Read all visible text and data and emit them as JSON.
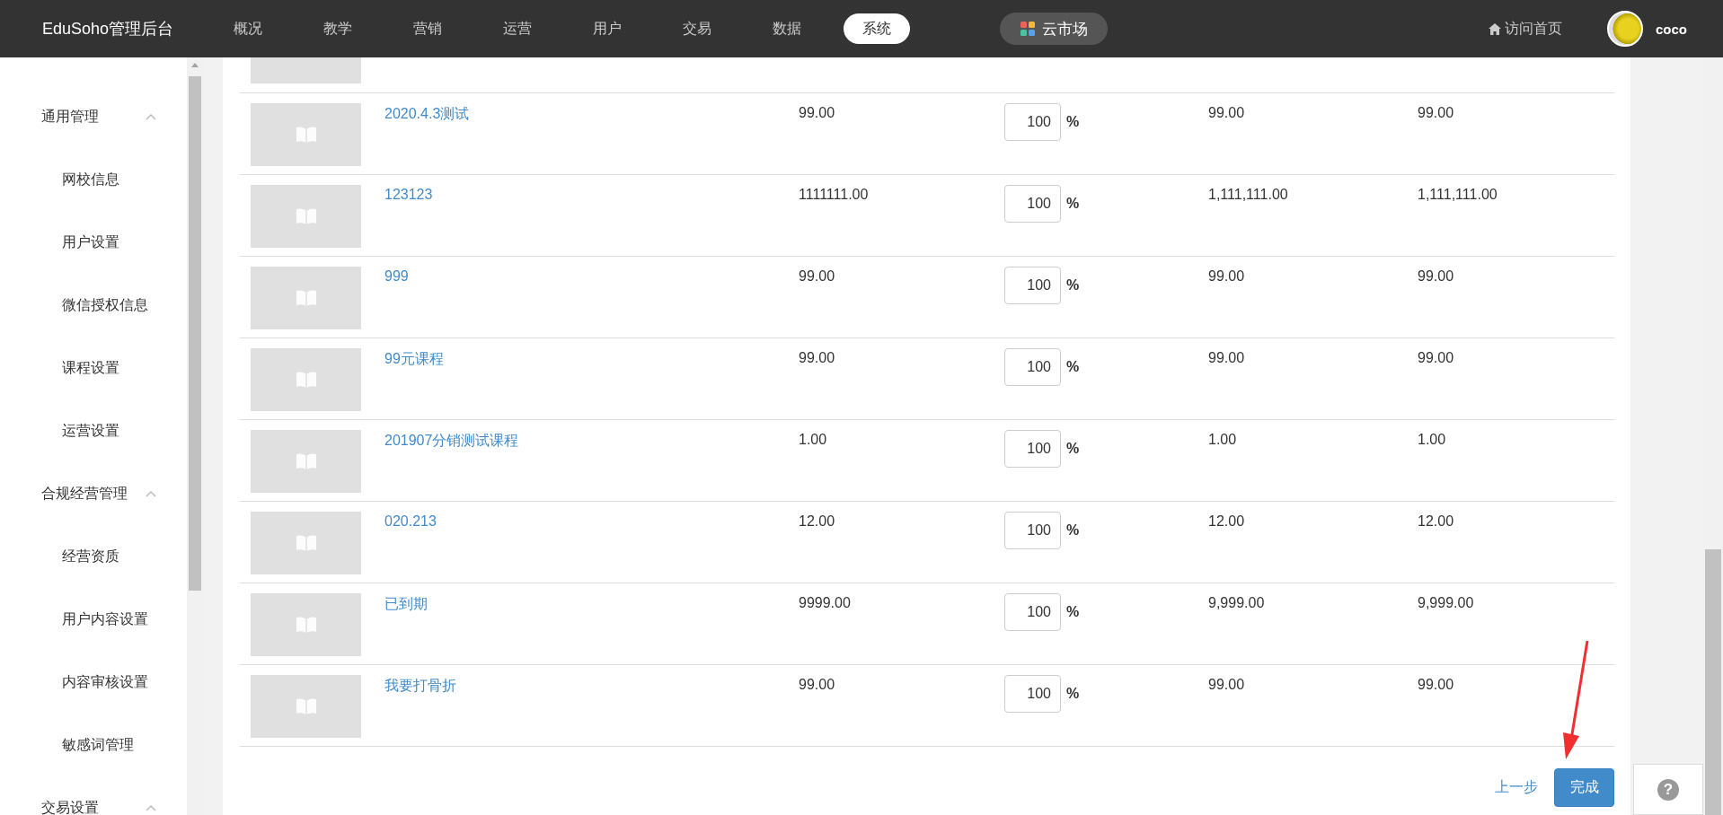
{
  "topbar": {
    "logo": "EduSoho管理后台",
    "nav": [
      {
        "label": "概况",
        "selected": false
      },
      {
        "label": "教学",
        "selected": false
      },
      {
        "label": "营销",
        "selected": false
      },
      {
        "label": "运营",
        "selected": false
      },
      {
        "label": "用户",
        "selected": false
      },
      {
        "label": "交易",
        "selected": false
      },
      {
        "label": "数据",
        "selected": false
      },
      {
        "label": "系统",
        "selected": true
      }
    ],
    "market": "云市场",
    "visit": "访问首页",
    "user": "coco"
  },
  "sidebar": {
    "groups": [
      {
        "label": "通用管理",
        "expanded": true,
        "children": [
          {
            "label": "网校信息"
          },
          {
            "label": "用户设置"
          },
          {
            "label": "微信授权信息"
          },
          {
            "label": "课程设置"
          },
          {
            "label": "运营设置"
          }
        ]
      },
      {
        "label": "合规经营管理",
        "expanded": true,
        "children": [
          {
            "label": "经营资质"
          },
          {
            "label": "用户内容设置"
          },
          {
            "label": "内容审核设置"
          },
          {
            "label": "敏感词管理"
          }
        ]
      },
      {
        "label": "交易设置",
        "expanded": true
      }
    ]
  },
  "table": {
    "cut_row_above": true,
    "rows": [
      {
        "title": "2020.4.3测试",
        "price": "99.00",
        "percent": "100",
        "unit": "%",
        "column_4": "99.00",
        "column_5": "99.00"
      },
      {
        "title": "123123",
        "price": "1111111.00",
        "percent": "100",
        "unit": "%",
        "column_4": "1,111,111.00",
        "column_5": "1,111,111.00"
      },
      {
        "title": "999",
        "price": "99.00",
        "percent": "100",
        "unit": "%",
        "column_4": "99.00",
        "column_5": "99.00"
      },
      {
        "title": "99元课程",
        "price": "99.00",
        "percent": "100",
        "unit": "%",
        "column_4": "99.00",
        "column_5": "99.00"
      },
      {
        "title": "201907分销测试课程",
        "price": "1.00",
        "percent": "100",
        "unit": "%",
        "column_4": "1.00",
        "column_5": "1.00"
      },
      {
        "title": "020.213",
        "price": "12.00",
        "percent": "100",
        "unit": "%",
        "column_4": "12.00",
        "column_5": "12.00"
      },
      {
        "title": "已到期",
        "price": "9999.00",
        "percent": "100",
        "unit": "%",
        "column_4": "9,999.00",
        "column_5": "9,999.00"
      },
      {
        "title": "我要打骨折",
        "price": "99.00",
        "percent": "100",
        "unit": "%",
        "column_4": "99.00",
        "column_5": "99.00"
      }
    ]
  },
  "actions": {
    "back": "上一步",
    "finish": "完成"
  },
  "help": "?"
}
